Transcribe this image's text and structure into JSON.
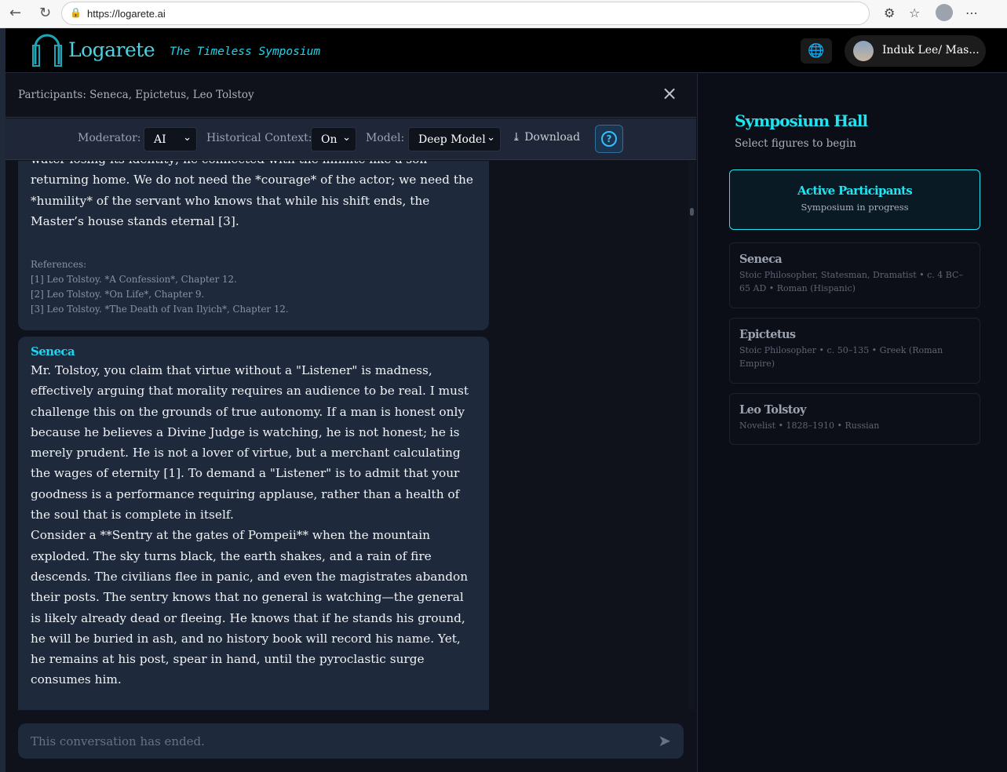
{
  "browser": {
    "url": "https://logarete.ai"
  },
  "header": {
    "logo": "Logarete",
    "tagline": "The Timeless Symposium",
    "user": "Induk Lee/ Mas..."
  },
  "participants_bar": {
    "text": "Participants: Seneca, Epictetus, Leo Tolstoy"
  },
  "controls": {
    "moderator_label": "Moderator:",
    "moderator_value": "AI",
    "context_label": "Historical Context:",
    "context_value": "On",
    "model_label": "Model:",
    "model_value": "Deep Model",
    "download": "Download"
  },
  "messages": [
    {
      "body": "water losing its identity; he connected with the infinite like a son returning home. We do not need the *courage* of the actor; we need the *humility* of the servant who knows that while his shift ends, the Master’s house stands eternal [3].",
      "refs_title": "References:",
      "refs": [
        "[1] Leo Tolstoy. *A Confession*, Chapter 12.",
        "[2] Leo Tolstoy. *On Life*, Chapter 9.",
        "[3] Leo Tolstoy. *The Death of Ivan Ilyich*, Chapter 12."
      ]
    },
    {
      "speaker": "Seneca",
      "p1": "Mr. Tolstoy, you claim that virtue without a \"Listener\" is madness, effectively arguing that morality requires an audience to be real. I must challenge this on the grounds of true autonomy. If a man is honest only because he believes a Divine Judge is watching, he is not honest; he is merely prudent. He is not a lover of virtue, but a merchant calculating the wages of eternity [1]. To demand a \"Listener\" is to admit that your goodness is a performance requiring applause, rather than a health of the soul that is complete in itself.",
      "p2": "Consider a **Sentry at the gates of Pompeii** when the mountain exploded. The sky turns black, the earth shakes, and a rain of fire descends. The civilians flee in panic, and even the magistrates abandon their posts. The sentry knows that no general is watching—the general is likely already dead or fleeing. He knows that if he stands his ground, he will be buried in ash, and no history book will record his name. Yet, he remains at his post, spear in hand, until the pyroclastic surge consumes him."
    }
  ],
  "input": {
    "placeholder": "This conversation has ended."
  },
  "sidebar": {
    "title": "Symposium Hall",
    "subtitle": "Select figures to begin",
    "active_title": "Active Participants",
    "active_sub": "Symposium in progress",
    "figures": [
      {
        "name": "Seneca",
        "desc": "Stoic Philosopher, Statesman, Dramatist • c. 4 BC–65 AD • Roman (Hispanic)"
      },
      {
        "name": "Epictetus",
        "desc": "Stoic Philosopher • c. 50–135 • Greek (Roman Empire)"
      },
      {
        "name": "Leo Tolstoy",
        "desc": "Novelist • 1828–1910 • Russian"
      }
    ]
  },
  "colors": {
    "accent": "#22e3f0",
    "bubble": "#1e293b",
    "panel": "#0f121b"
  }
}
